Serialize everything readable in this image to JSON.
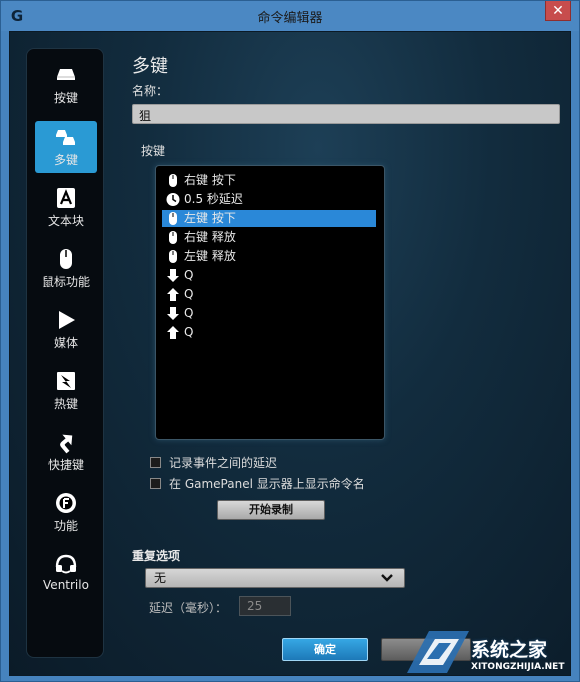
{
  "window": {
    "title": "命令编辑器",
    "app_icon": "G",
    "close_glyph": "✕"
  },
  "sidebar": {
    "items": [
      {
        "label": "按键",
        "icon": "key-icon",
        "active": false
      },
      {
        "label": "多键",
        "icon": "multikey-icon",
        "active": true
      },
      {
        "label": "文本块",
        "icon": "text-block-icon",
        "active": false
      },
      {
        "label": "鼠标功能",
        "icon": "mouse-icon",
        "active": false
      },
      {
        "label": "媒体",
        "icon": "play-icon",
        "active": false
      },
      {
        "label": "热键",
        "icon": "hotkey-icon",
        "active": false
      },
      {
        "label": "快捷键",
        "icon": "shortcut-arrow-icon",
        "active": false
      },
      {
        "label": "功能",
        "icon": "function-icon",
        "active": false
      },
      {
        "label": "Ventrilo",
        "icon": "headset-icon",
        "active": false
      }
    ]
  },
  "main": {
    "heading": "多键",
    "name_label": "名称：",
    "name_value": "狙",
    "keys_label": "按键",
    "key_list": [
      {
        "icon": "mouse-icon",
        "text": "右键 按下",
        "selected": false
      },
      {
        "icon": "clock-icon",
        "text": "0.5 秒延迟",
        "selected": false
      },
      {
        "icon": "mouse-icon",
        "text": "左键 按下",
        "selected": true
      },
      {
        "icon": "mouse-icon",
        "text": "右键 释放",
        "selected": false
      },
      {
        "icon": "mouse-icon",
        "text": "左键 释放",
        "selected": false
      },
      {
        "icon": "arrow-down-icon",
        "text": "Q",
        "selected": false
      },
      {
        "icon": "arrow-up-icon",
        "text": "Q",
        "selected": false
      },
      {
        "icon": "arrow-down-icon",
        "text": "Q",
        "selected": false
      },
      {
        "icon": "arrow-up-icon",
        "text": "Q",
        "selected": false
      }
    ],
    "options": {
      "record_delays_label": "记录事件之间的延迟",
      "record_delays_checked": false,
      "show_name_label": "在 GamePanel 显示器上显示命令名",
      "show_name_checked": false
    },
    "record_button": "开始录制",
    "repeat_label": "重复选项",
    "repeat_value": "无",
    "delay_label": "延迟（毫秒）：",
    "delay_value": "25",
    "ok_button": "确定",
    "cancel_button": ""
  },
  "watermark": {
    "text": "系统之家",
    "url": "XITONGZHIJIA.NET"
  },
  "colors": {
    "accent": "#2a9ad4",
    "selection": "#2a88d8",
    "window": "#4683be"
  }
}
